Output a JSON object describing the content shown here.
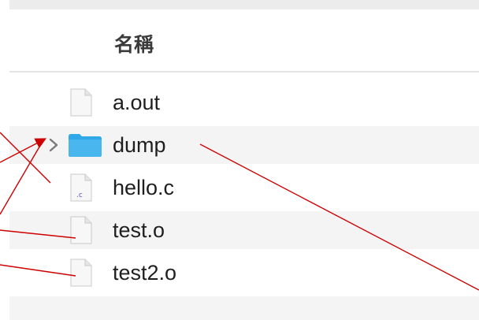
{
  "header": {
    "name_column": "名稱"
  },
  "files": [
    {
      "name": "a.out",
      "kind": "file"
    },
    {
      "name": "dump",
      "kind": "folder"
    },
    {
      "name": "hello.c",
      "kind": "c-source",
      "badge": ".c"
    },
    {
      "name": "test.o",
      "kind": "file"
    },
    {
      "name": "test2.o",
      "kind": "file"
    }
  ],
  "colors": {
    "folder": "#2ea8e8",
    "folder_tab": "#5cc2f2",
    "annotation_arrow": "#cc0000",
    "c_badge": "#6a4bb0"
  }
}
